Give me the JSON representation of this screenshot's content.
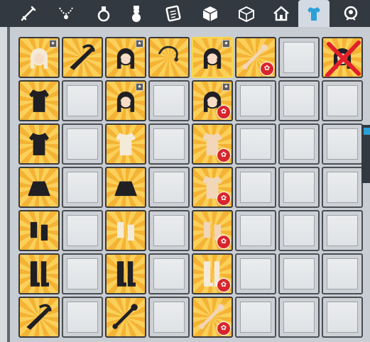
{
  "toolbar": {
    "tabs": [
      {
        "name": "sword-tab",
        "icon": "sword-icon"
      },
      {
        "name": "necklace-tab",
        "icon": "necklace-icon"
      },
      {
        "name": "potion-tab",
        "icon": "potion-icon"
      },
      {
        "name": "snowman-tab",
        "icon": "snowman-icon"
      },
      {
        "name": "scroll-tab",
        "icon": "scroll-icon"
      },
      {
        "name": "box-tab",
        "icon": "box-icon"
      },
      {
        "name": "box-open-tab",
        "icon": "box-open-icon"
      },
      {
        "name": "house-tab",
        "icon": "house-icon"
      },
      {
        "name": "outfit-tab",
        "icon": "shirt-icon",
        "active": true
      },
      {
        "name": "character-tab",
        "icon": "character-icon"
      }
    ]
  },
  "inventory": {
    "columns": 8,
    "rows": [
      [
        "hair-white",
        "weapon-dark",
        "hair-black",
        "whip",
        "hair-black-long",
        "bone-mace",
        "empty",
        "hair-crossed"
      ],
      [
        "outfit-black",
        "empty",
        "hair-black",
        "empty",
        "hair-black-long",
        "empty",
        "empty",
        "empty"
      ],
      [
        "jacket-black",
        "empty",
        "jacket-white",
        "empty",
        "top-beige",
        "empty",
        "empty",
        "empty"
      ],
      [
        "skirt-black",
        "empty",
        "skirt-black-pleated",
        "empty",
        "jacket-beige",
        "empty",
        "empty",
        "empty"
      ],
      [
        "gloves-black",
        "empty",
        "gloves-black-white",
        "empty",
        "gloves-beige",
        "empty",
        "empty",
        "empty"
      ],
      [
        "boots-black",
        "empty",
        "boots-black-tall",
        "empty",
        "boots-white",
        "empty",
        "empty",
        "empty"
      ],
      [
        "wings-dark",
        "empty",
        "accessory-orb",
        "empty",
        "accessory-gold",
        "empty",
        "empty",
        "empty"
      ]
    ],
    "starred": [
      "0-0",
      "0-2",
      "0-4",
      "1-2",
      "1-4"
    ],
    "paw_marked": [
      "0-5",
      "1-4",
      "2-4",
      "3-4",
      "4-4",
      "5-4",
      "6-4"
    ],
    "selected": "0-4",
    "crossed": "0-7"
  },
  "colors": {
    "accent": "#2aa0d8",
    "item_bg": "#f4b334",
    "paw": "#d8252c",
    "cross": "#e1202a"
  }
}
